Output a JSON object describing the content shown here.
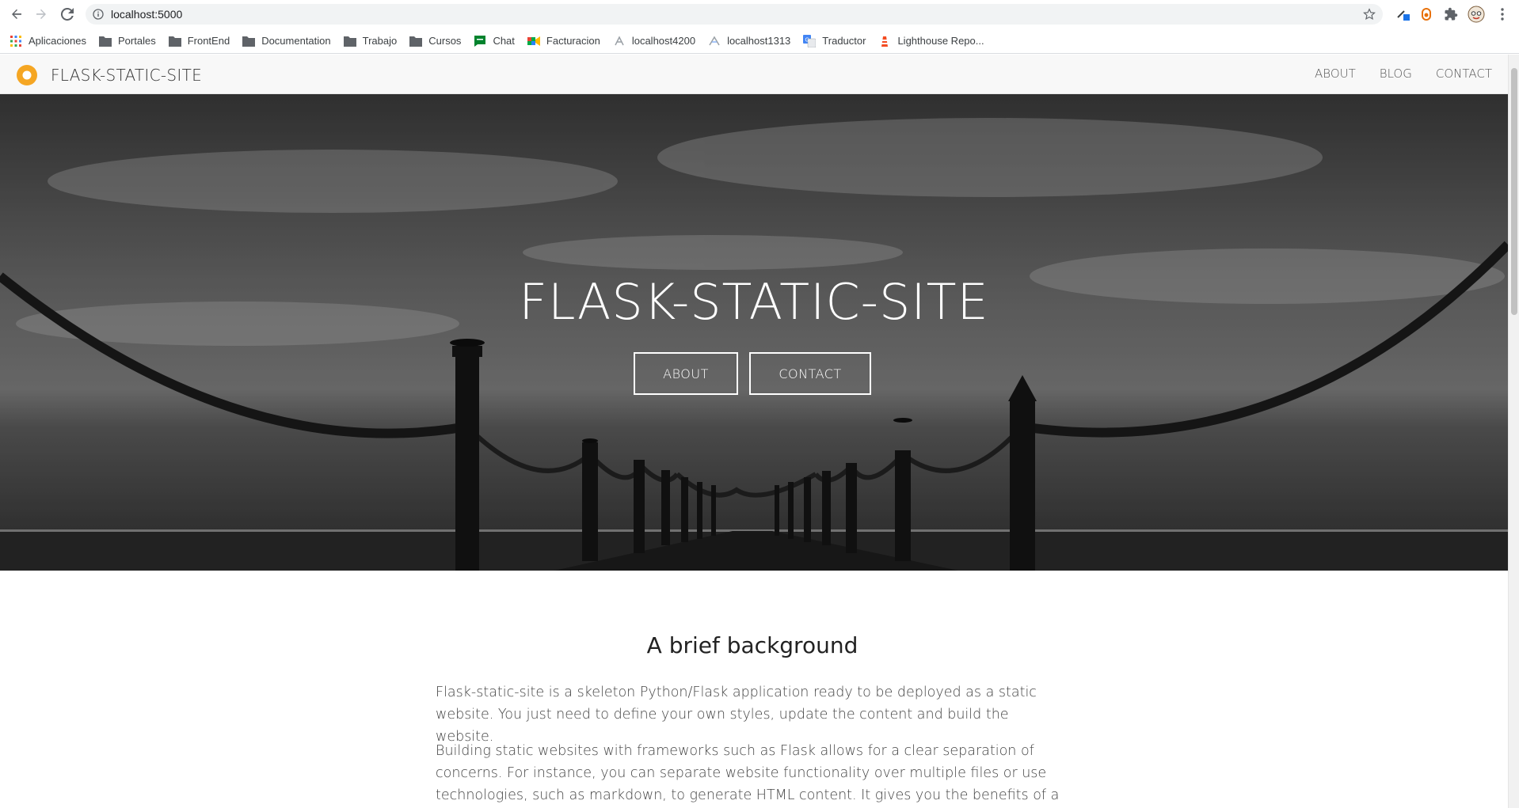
{
  "browser": {
    "url": "localhost:5000",
    "bookmarks": [
      {
        "label": "Aplicaciones",
        "icon": "apps-grid-icon"
      },
      {
        "label": "Portales",
        "icon": "folder-icon"
      },
      {
        "label": "FrontEnd",
        "icon": "folder-icon"
      },
      {
        "label": "Documentation",
        "icon": "folder-icon"
      },
      {
        "label": "Trabajo",
        "icon": "folder-icon"
      },
      {
        "label": "Cursos",
        "icon": "folder-icon"
      },
      {
        "label": "Chat",
        "icon": "chat-icon"
      },
      {
        "label": "Facturacion",
        "icon": "meet-icon"
      },
      {
        "label": "localhost4200",
        "icon": "angular-icon"
      },
      {
        "label": "localhost1313",
        "icon": "hugo-icon"
      },
      {
        "label": "Traductor",
        "icon": "translate-icon"
      },
      {
        "label": "Lighthouse Repo...",
        "icon": "lighthouse-icon"
      }
    ]
  },
  "site": {
    "brand": "FLASK-STATIC-SITE",
    "nav": [
      "ABOUT",
      "BLOG",
      "CONTACT"
    ],
    "accent": "#f5a623"
  },
  "hero": {
    "title": "FLASK-STATIC-SITE",
    "buttons": [
      "ABOUT",
      "CONTACT"
    ]
  },
  "content": {
    "heading": "A brief background",
    "paragraph1": "Flask-static-site is a skeleton Python/Flask application ready to be deployed as a static website. You just need to define your own styles, update the content and build the website.",
    "paragraph2": "Building static websites with frameworks such as Flask allows for a clear separation of concerns. For instance, you can separate website functionality over multiple files or use technologies, such as markdown, to generate HTML content. It gives you the benefits of a dynamic framework with the"
  }
}
